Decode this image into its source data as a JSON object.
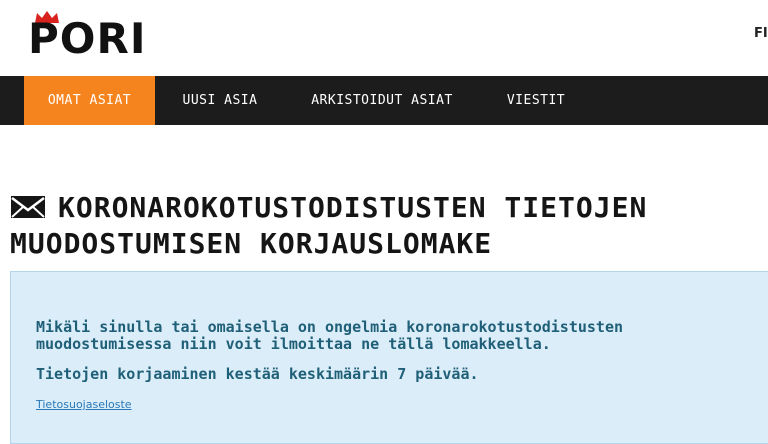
{
  "header": {
    "logo_text": "PORI",
    "language": "FI"
  },
  "nav": {
    "items": [
      {
        "label": "OMAT ASIAT",
        "active": true
      },
      {
        "label": "UUSI ASIA",
        "active": false
      },
      {
        "label": "ARKISTOIDUT ASIAT",
        "active": false
      },
      {
        "label": "VIESTIT",
        "active": false
      }
    ]
  },
  "page": {
    "title_icon": "envelope-icon",
    "title": "KORONAROKOTUSTODISTUSTEN TIETOJEN MUODOSTUMISEN KORJAUSLOMAKE"
  },
  "info": {
    "paragraph1": "Mikäli sinulla tai omaisella on ongelmia koronarokotustodistusten muodostumisessa niin voit ilmoittaa ne tällä lomakkeella.",
    "paragraph2": "Tietojen korjaaminen kestää keskimäärin 7 päivää.",
    "link": "Tietosuojaseloste"
  },
  "colors": {
    "accent": "#f5841f",
    "nav_bg": "#1c1c1c",
    "info_bg": "#daedf8",
    "info_text": "#1f5f78",
    "link": "#2a78b8"
  }
}
